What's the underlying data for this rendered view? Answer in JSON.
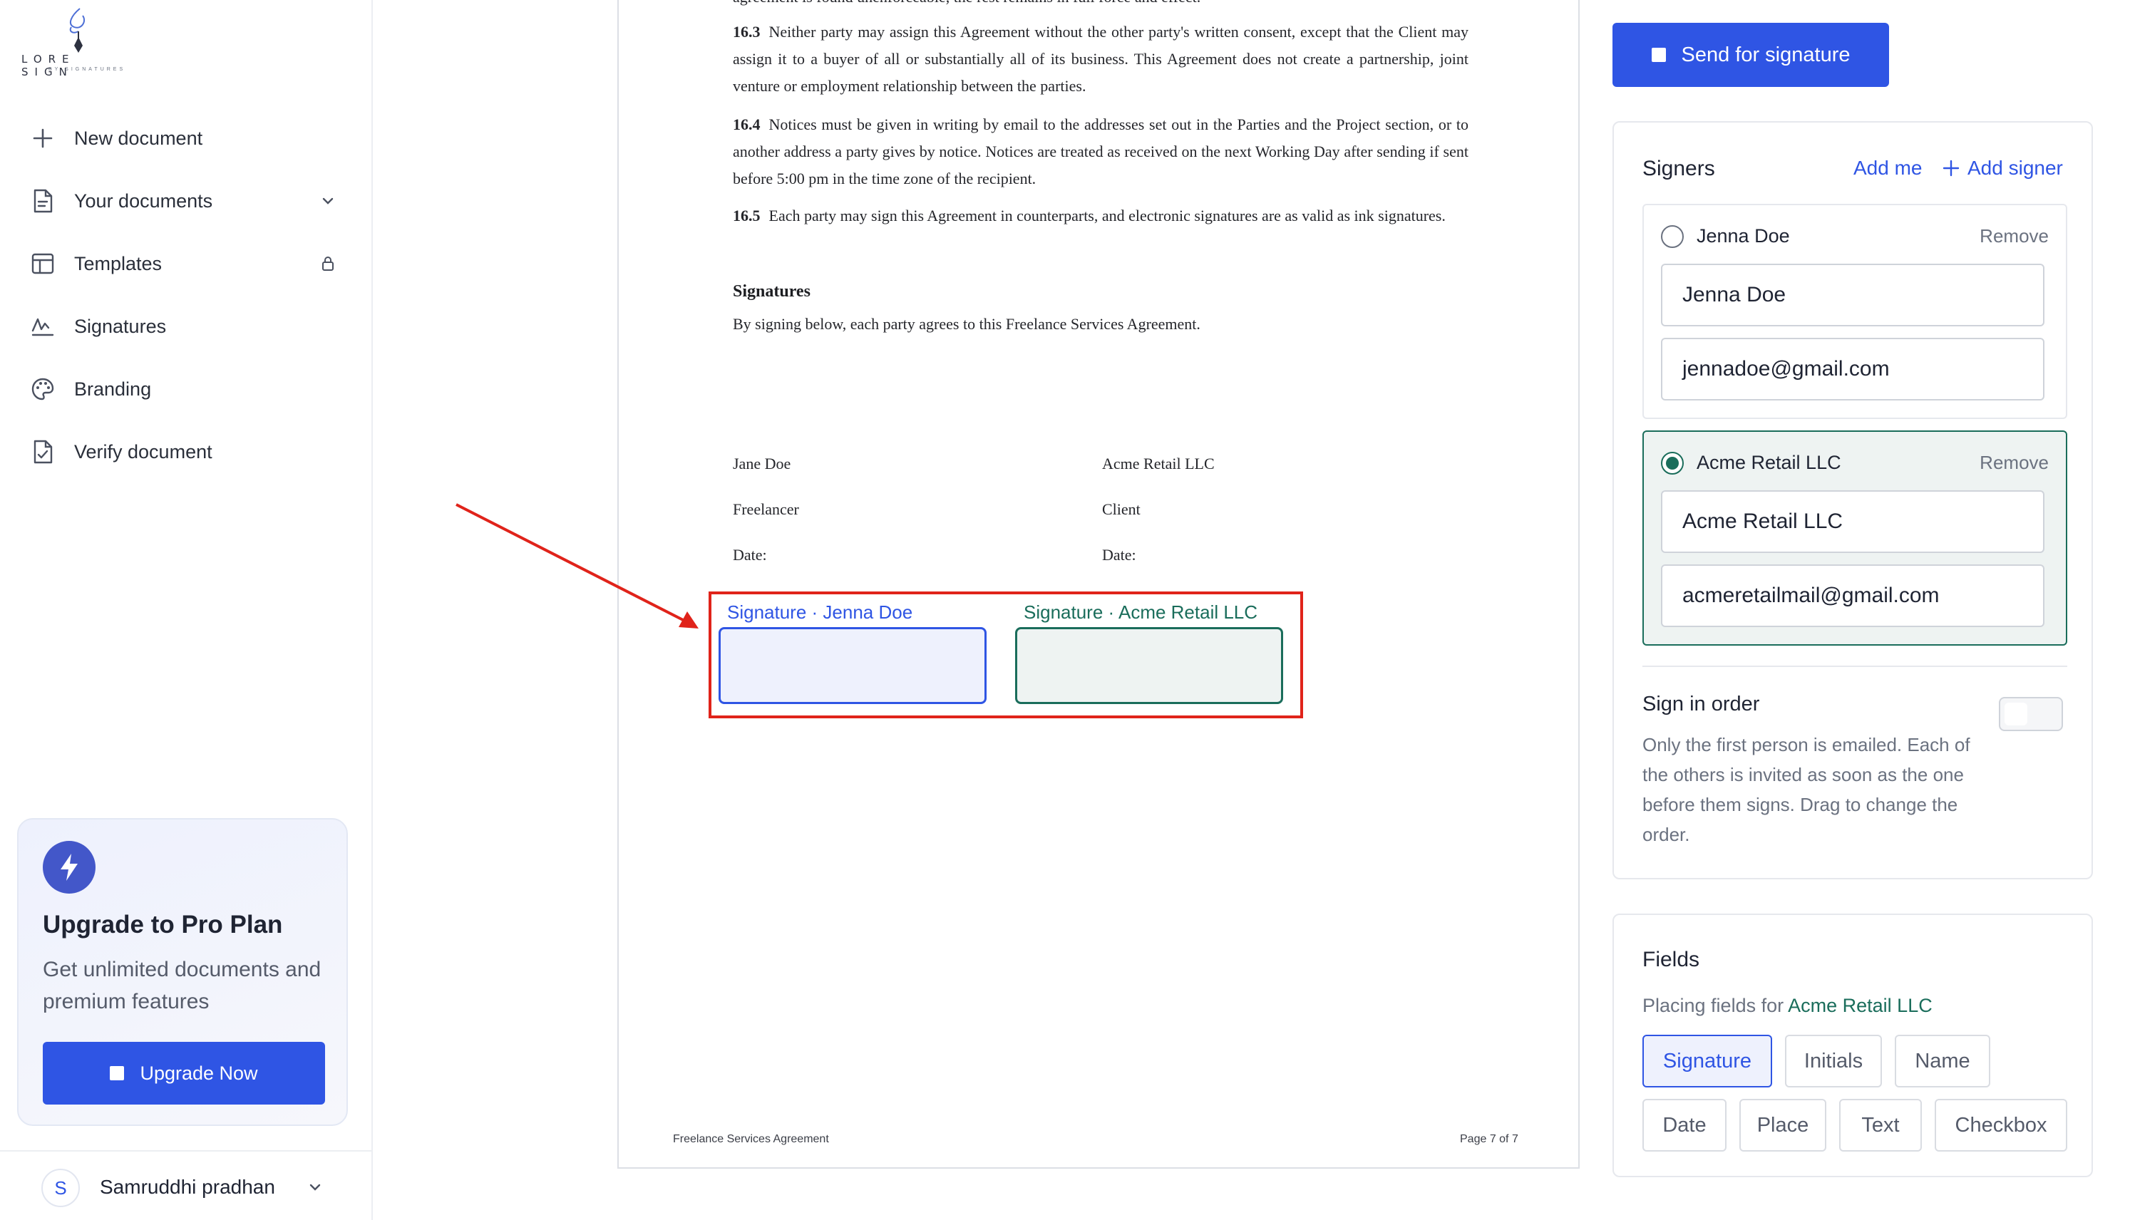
{
  "logo": {
    "word": "LORE SIGN",
    "sub": "BY SIGNATURES"
  },
  "nav": {
    "items": [
      {
        "label": "New document"
      },
      {
        "label": "Your documents"
      },
      {
        "label": "Templates"
      },
      {
        "label": "Signatures"
      },
      {
        "label": "Branding"
      },
      {
        "label": "Verify document"
      }
    ]
  },
  "upgrade": {
    "title": "Upgrade to Pro Plan",
    "description": "Get unlimited documents and premium features",
    "button": "Upgrade Now"
  },
  "user": {
    "initial": "S",
    "name": "Samruddhi pradhan"
  },
  "document": {
    "cut_line": "agreement is found unenforceable, the rest remains in full force and effect.",
    "p163_num": "16.3",
    "p163": "Neither party may assign this Agreement without the other party's written consent, except that the Client may assign it to a buyer of all or substantially all of its business. This Agreement does not create a partnership, joint venture or employment relationship between the parties.",
    "p164_num": "16.4",
    "p164": "Notices must be given in writing by email to the addresses set out in the Parties and the Project section, or to another address a party gives by notice. Notices are treated as received on the next Working Day after sending if sent before 5:00 pm in the time zone of the recipient.",
    "p165_num": "16.5",
    "p165": "Each party may sign this Agreement in counterparts, and electronic signatures are as valid as ink signatures.",
    "signatures_heading": "Signatures",
    "signatures_intro": "By signing below, each party agrees to this Freelance Services Agreement.",
    "party_left": {
      "name": "Jane Doe",
      "role": "Freelancer",
      "date": "Date:"
    },
    "party_right": {
      "name": "Acme Retail LLC",
      "role": "Client",
      "date": "Date:"
    },
    "sig_label_jenna": "Signature · Jenna Doe",
    "sig_label_acme": "Signature · Acme Retail LLC",
    "footer_left": "Freelance Services Agreement",
    "footer_right": "Page 7 of 7"
  },
  "panel": {
    "send_button": "Send for signature",
    "signers_title": "Signers",
    "add_me": "Add me",
    "add_signer": "Add signer",
    "remove": "Remove",
    "signers": [
      {
        "name": "Jenna Doe",
        "name_value": "Jenna Doe",
        "email_value": "jennadoe@gmail.com"
      },
      {
        "name": "Acme Retail LLC",
        "name_value": "Acme Retail LLC",
        "email_value": "acmeretailmail@gmail.com"
      }
    ],
    "sign_in_order_title": "Sign in order",
    "sign_in_order_desc": "Only the first person is emailed. Each of the others is invited as soon as the one before them signs. Drag to change the order.",
    "fields_title": "Fields",
    "fields_sub_prefix": "Placing fields for",
    "fields_sub_target": "Acme Retail LLC",
    "field_types": [
      "Signature",
      "Initials",
      "Name",
      "Date",
      "Place",
      "Text",
      "Checkbox"
    ]
  },
  "colors": {
    "primary": "#2f55e4",
    "accent_green": "#1a6d5b",
    "annotation_red": "#e0231a"
  }
}
